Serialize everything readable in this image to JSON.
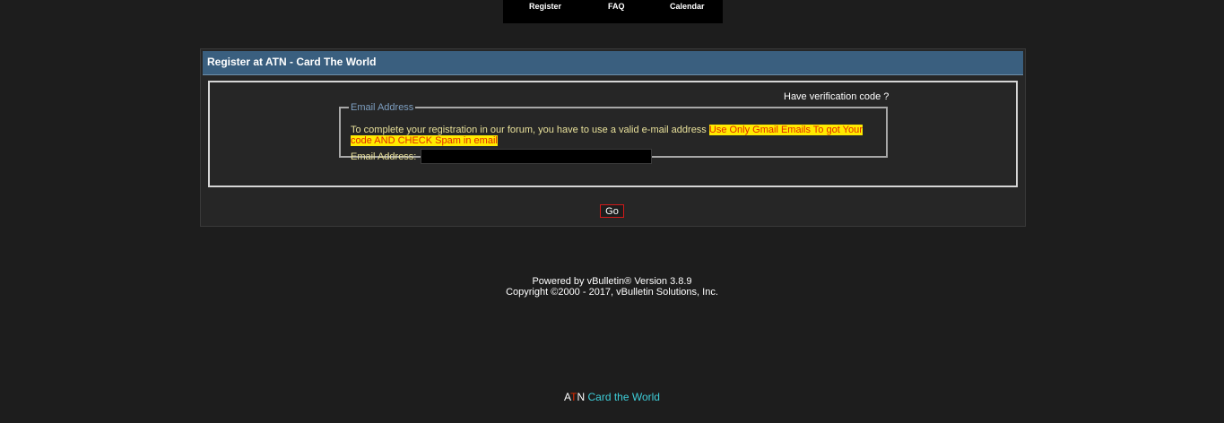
{
  "nav": {
    "register": "Register",
    "faq": "FAQ",
    "calendar": "Calendar"
  },
  "panel": {
    "title": "Register at ATN - Card The World",
    "verification_link": "Have verification code ?",
    "fieldset_legend": "Email Address",
    "description_plain": "To complete your registration in our forum, you have to use a valid e-mail address ",
    "description_highlight": "Use Only Gmail Emails To got Your code AND CHECK Spam in email",
    "email_label": "Email Address:",
    "email_value": "",
    "go_label": "Go"
  },
  "footer": {
    "powered": "Powered by vBulletin® Version 3.8.9",
    "copyright": "Copyright ©2000 - 2017, vBulletin Solutions, Inc."
  },
  "brand": {
    "a": "A",
    "t": "T",
    "n": "N",
    "rest": " Card the World"
  },
  "colors": {
    "background": "#1d1d1d",
    "header_bar": "#3a5f7f",
    "highlight_bg": "#ffea00",
    "highlight_text": "#e02a00",
    "label_text": "#e8e09a",
    "legend_text": "#7d9ec0",
    "brand_cyan": "#3ecdd8"
  }
}
